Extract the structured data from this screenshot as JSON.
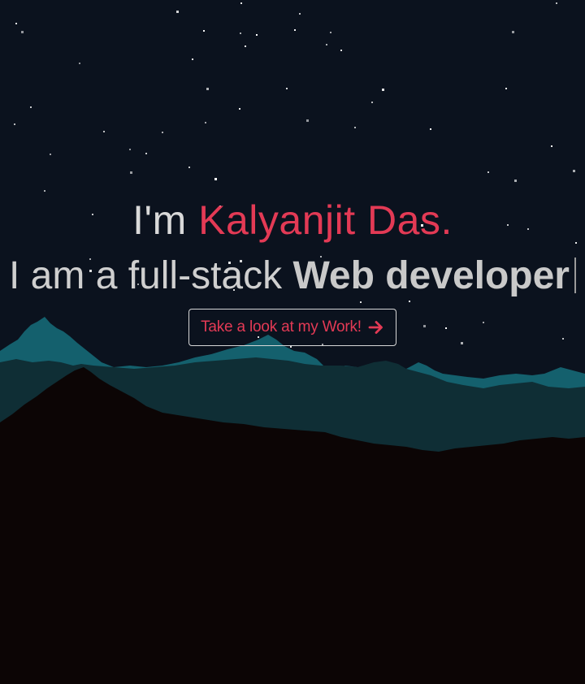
{
  "hero": {
    "greeting_prefix": "I'm",
    "name": "Kalyanjit Das.",
    "tagline_prefix": "I am a full-stack",
    "tagline_role": "Web developer",
    "cta_label": "Take a look at my Work!"
  },
  "icons": {
    "cta_icon": "arrow-right-icon"
  },
  "colors": {
    "sky": "#0b121e",
    "accent": "#e33a55",
    "mountain_back": "#14606d",
    "mountain_mid": "#0f2e35",
    "ground": "#0c0505"
  }
}
